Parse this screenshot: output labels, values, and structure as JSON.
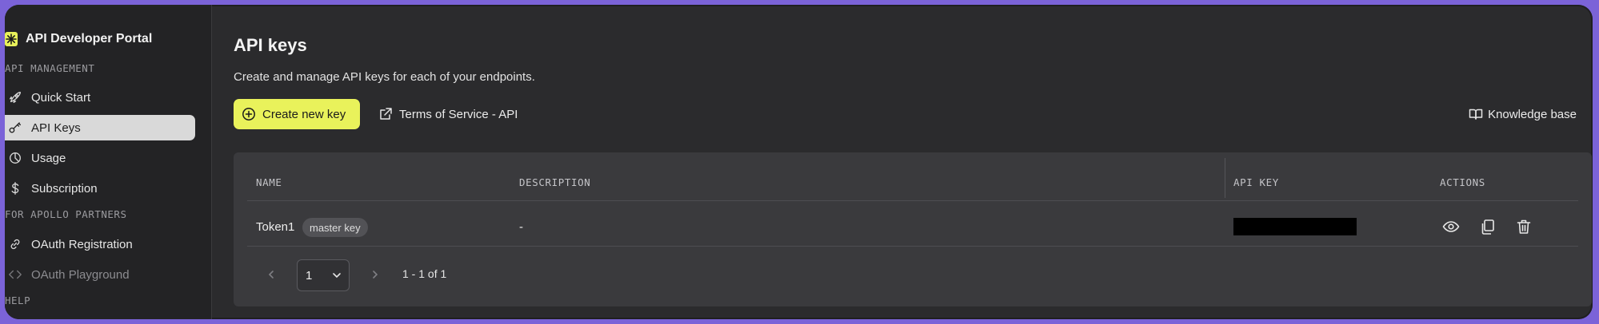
{
  "app": {
    "title": "API Developer Portal",
    "logo_icon": "asterisk-logo-icon",
    "accent": "#e9f25b"
  },
  "sidebar": {
    "sections": [
      {
        "label": "API MANAGEMENT"
      },
      {
        "label": "FOR APOLLO PARTNERS"
      },
      {
        "label": "HELP"
      }
    ],
    "items": [
      {
        "label": "Quick Start",
        "icon": "rocket-icon"
      },
      {
        "label": "API Keys",
        "icon": "key-icon",
        "active": true
      },
      {
        "label": "Usage",
        "icon": "pie-chart-icon"
      },
      {
        "label": "Subscription",
        "icon": "dollar-icon"
      },
      {
        "label": "OAuth Registration",
        "icon": "link-icon"
      },
      {
        "label": "OAuth Playground",
        "icon": "code-icon"
      }
    ]
  },
  "main": {
    "title": "API keys",
    "subtitle": "Create and manage API keys for each of your endpoints.",
    "create_button": "Create new key",
    "tos_link": "Terms of Service - API",
    "kb_link": "Knowledge base"
  },
  "table": {
    "columns": [
      "NAME",
      "DESCRIPTION",
      "API KEY",
      "ACTIONS"
    ],
    "rows": [
      {
        "name": "Token1",
        "badge": "master key",
        "description": "-",
        "api_key": "",
        "actions": [
          "eye-icon",
          "copy-icon",
          "trash-icon"
        ]
      }
    ]
  },
  "pagination": {
    "page": "1",
    "range": "1 - 1 of 1"
  }
}
